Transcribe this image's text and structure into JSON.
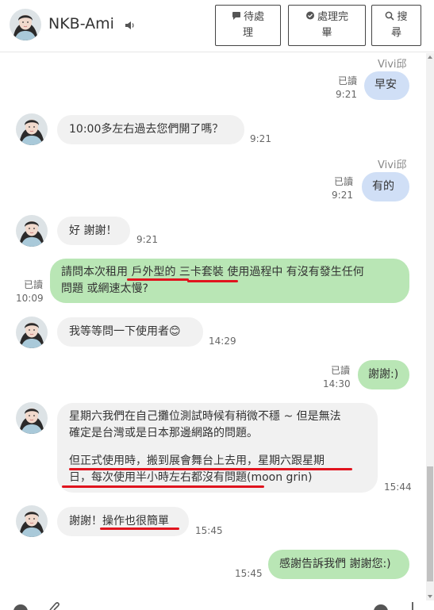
{
  "header": {
    "contact_name": "NKB-Ami",
    "buttons": [
      {
        "line1": "待處",
        "line2": "理"
      },
      {
        "line1": "處理完",
        "line2": "畢"
      },
      {
        "line1": "搜",
        "line2": "尋"
      }
    ]
  },
  "messages": [
    {
      "dir": "out",
      "sender": "Vivi邱",
      "text": "早安",
      "read": "已讀",
      "time": "9:21"
    },
    {
      "dir": "in",
      "text": "10:00多左右過去您們開了嗎？",
      "time": "9:21"
    },
    {
      "dir": "out",
      "sender": "Vivi邱",
      "text": "有的",
      "read": "已讀",
      "time": "9:21"
    },
    {
      "dir": "in",
      "text": "好 謝謝！",
      "time": "9:21"
    },
    {
      "dir": "out",
      "line1": "請問本次租用 戶外型的 三卡套裝 使用過程中 有沒有發生任何",
      "line2": "問題 或網速太慢?",
      "read": "已讀",
      "time": "10:09"
    },
    {
      "dir": "in",
      "text": "我等等問一下使用者😊",
      "time": "14:29"
    },
    {
      "dir": "out",
      "text": "謝謝:)",
      "read": "已讀",
      "time": "14:30"
    },
    {
      "dir": "in",
      "line1": "星期六我們在自己攤位測試時候有稍微不穩 ~ 但是無法",
      "line2": "確定是台灣或是日本那邊網路的問題。",
      "line3": "但正式使用時，搬到展會舞台上去用，星期六跟星期",
      "line4": "日，每次使用半小時左右都沒有問題(moon grin)",
      "time": "15:44"
    },
    {
      "dir": "in",
      "text": "謝謝！操作也很簡單",
      "time": "15:45"
    },
    {
      "dir": "out",
      "text": "感謝告訴我們 謝謝您:)",
      "time": "15:45"
    }
  ],
  "colors": {
    "incoming": "#f1f1f1",
    "outgoing_short": "#d0dff6",
    "outgoing_long": "#b9e6b5",
    "highlight": "#e0141e"
  }
}
